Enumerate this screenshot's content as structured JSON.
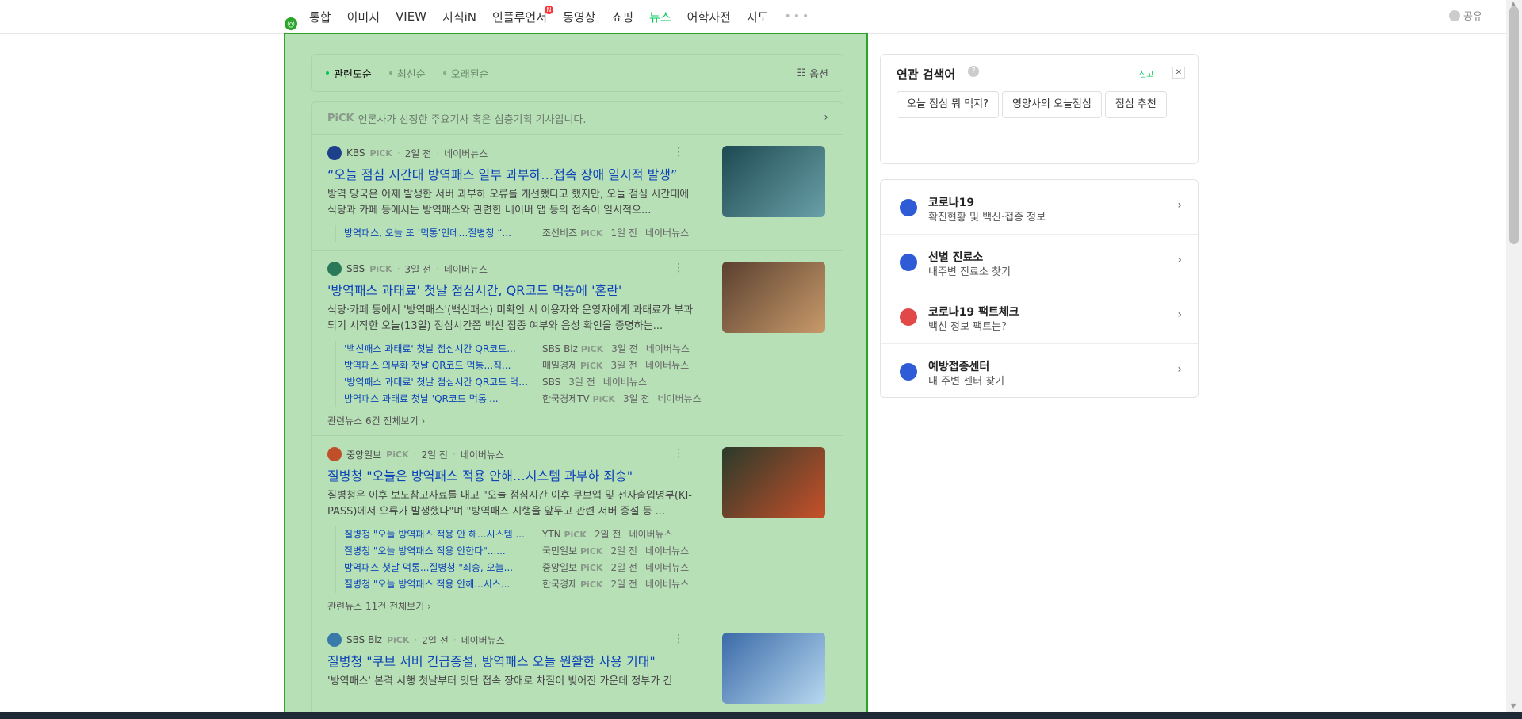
{
  "tabs": [
    {
      "label": "통합"
    },
    {
      "label": "이미지"
    },
    {
      "label": "VIEW"
    },
    {
      "label": "지식iN"
    },
    {
      "label": "인플루언서",
      "badge": "N"
    },
    {
      "label": "동영상"
    },
    {
      "label": "쇼핑"
    },
    {
      "label": "뉴스",
      "active": true
    },
    {
      "label": "어학사전"
    },
    {
      "label": "지도"
    }
  ],
  "more_dots": "•••",
  "share_label": "공유",
  "sort": {
    "options": [
      "관련도순",
      "최신순",
      "오래된순"
    ],
    "option_label": "옵션"
  },
  "pick_bar": {
    "pick": "PiCK",
    "text": "언론사가 선정한 주요기사 혹은 심층기획 기사입니다."
  },
  "articles": [
    {
      "press": "KBS",
      "pick": "PiCK",
      "time": "2일 전",
      "source": "네이버뉴스",
      "title": "“오늘 점심 시간대 방역패스 일부 과부하…접속 장애 일시적 발생”",
      "desc": "방역 당국은 어제 발생한 서버 과부하 오류를 개선했다고 했지만, 오늘 점심 시간대에 식당과 카페 등에서는 방역패스와 관련한 네이버 앱 등의 접속이 일시적으...",
      "related": [
        {
          "title": "방역패스, 오늘 또 ‘먹통’인데…질병청 “...",
          "press": "조선비즈",
          "pick": "PiCK",
          "time": "1일 전",
          "source": "네이버뉴스"
        }
      ],
      "viewall": ""
    },
    {
      "press": "SBS",
      "pick": "PiCK",
      "time": "3일 전",
      "source": "네이버뉴스",
      "title": "'방역패스 과태료' 첫날 점심시간, QR코드 먹통에 '혼란'",
      "desc": "식당·카페 등에서 '방역패스'(백신패스) 미확인 시 이용자와 운영자에게 과태료가 부과되기 시작한 오늘(13일) 점심시간쯤 백신 접종 여부와 음성 확인을 증명하는...",
      "related": [
        {
          "title": "'백신패스 과태료' 첫날 점심시간 QR코드...",
          "press": "SBS Biz",
          "pick": "PiCK",
          "time": "3일 전",
          "source": "네이버뉴스"
        },
        {
          "title": "방역패스 의무화 첫날 QR코드 먹통...직...",
          "press": "매일경제",
          "pick": "PiCK",
          "time": "3일 전",
          "source": "네이버뉴스"
        },
        {
          "title": "'방역패스 과태료' 첫날 점심시간 QR코드 먹통 혼란",
          "press": "SBS",
          "pick": "",
          "time": "3일 전",
          "source": "네이버뉴스"
        },
        {
          "title": "방역패스 과태료 첫날 'QR코드 먹통'...",
          "press": "한국경제TV",
          "pick": "PiCK",
          "time": "3일 전",
          "source": "네이버뉴스"
        }
      ],
      "viewall": "관련뉴스 6건 전체보기 ›"
    },
    {
      "press": "중앙일보",
      "pick": "PiCK",
      "time": "2일 전",
      "source": "네이버뉴스",
      "title": "질병청 \"오늘은 방역패스 적용 안해…시스템 과부하 죄송\"",
      "desc": "질병청은 이후 보도참고자료를 내고 \"오늘 점심시간 이후 쿠브앱 및 전자출입명부(KI-PASS)에서 오류가 발생했다\"며 \"방역패스 시행을 앞두고 관련 서버 증설 등 ...",
      "related": [
        {
          "title": "질병청 \"오늘 방역패스 적용 안 해...시스템 ...",
          "press": "YTN",
          "pick": "PiCK",
          "time": "2일 전",
          "source": "네이버뉴스"
        },
        {
          "title": "질병청 \"오늘 방역패스 적용 안한다\"......",
          "press": "국민일보",
          "pick": "PiCK",
          "time": "2일 전",
          "source": "네이버뉴스"
        },
        {
          "title": "방역패스 첫날 먹통...질병청 \"죄송, 오늘...",
          "press": "중앙일보",
          "pick": "PiCK",
          "time": "2일 전",
          "source": "네이버뉴스"
        },
        {
          "title": "질병청 \"오늘 방역패스 적용 안해...시스...",
          "press": "한국경제",
          "pick": "PiCK",
          "time": "2일 전",
          "source": "네이버뉴스"
        }
      ],
      "viewall": "관련뉴스 11건 전체보기 ›"
    },
    {
      "press": "SBS Biz",
      "pick": "PiCK",
      "time": "2일 전",
      "source": "네이버뉴스",
      "title": "질병청 \"쿠브 서버 긴급증설, 방역패스 오늘 원활한 사용 기대\"",
      "desc": "'방역패스' 본격 시행 첫날부터 잇단 접속 장애로 차질이 빚어진 가운데 정부가 긴",
      "related": [],
      "viewall": ""
    }
  ],
  "related_search": {
    "title": "연관 검색어",
    "help": "?",
    "report": "신고",
    "close": "✕",
    "chips": [
      "오늘 점심 뭐 먹지?",
      "영양사의 오늘점심",
      "점심 추천"
    ]
  },
  "corona_links": [
    {
      "title": "코로나19",
      "subtitle": "확진현황 및 백신·접종 정보",
      "color": "#2f5bd6"
    },
    {
      "title": "선별 진료소",
      "subtitle": "내주변 진료소 찾기",
      "color": "#2f5bd6"
    },
    {
      "title": "코로나19 팩트체크",
      "subtitle": "백신 정보 팩트는?",
      "color": "#e34848"
    },
    {
      "title": "예방접종센터",
      "subtitle": "내 주변 센터 찾기",
      "color": "#2f5bd6"
    }
  ]
}
